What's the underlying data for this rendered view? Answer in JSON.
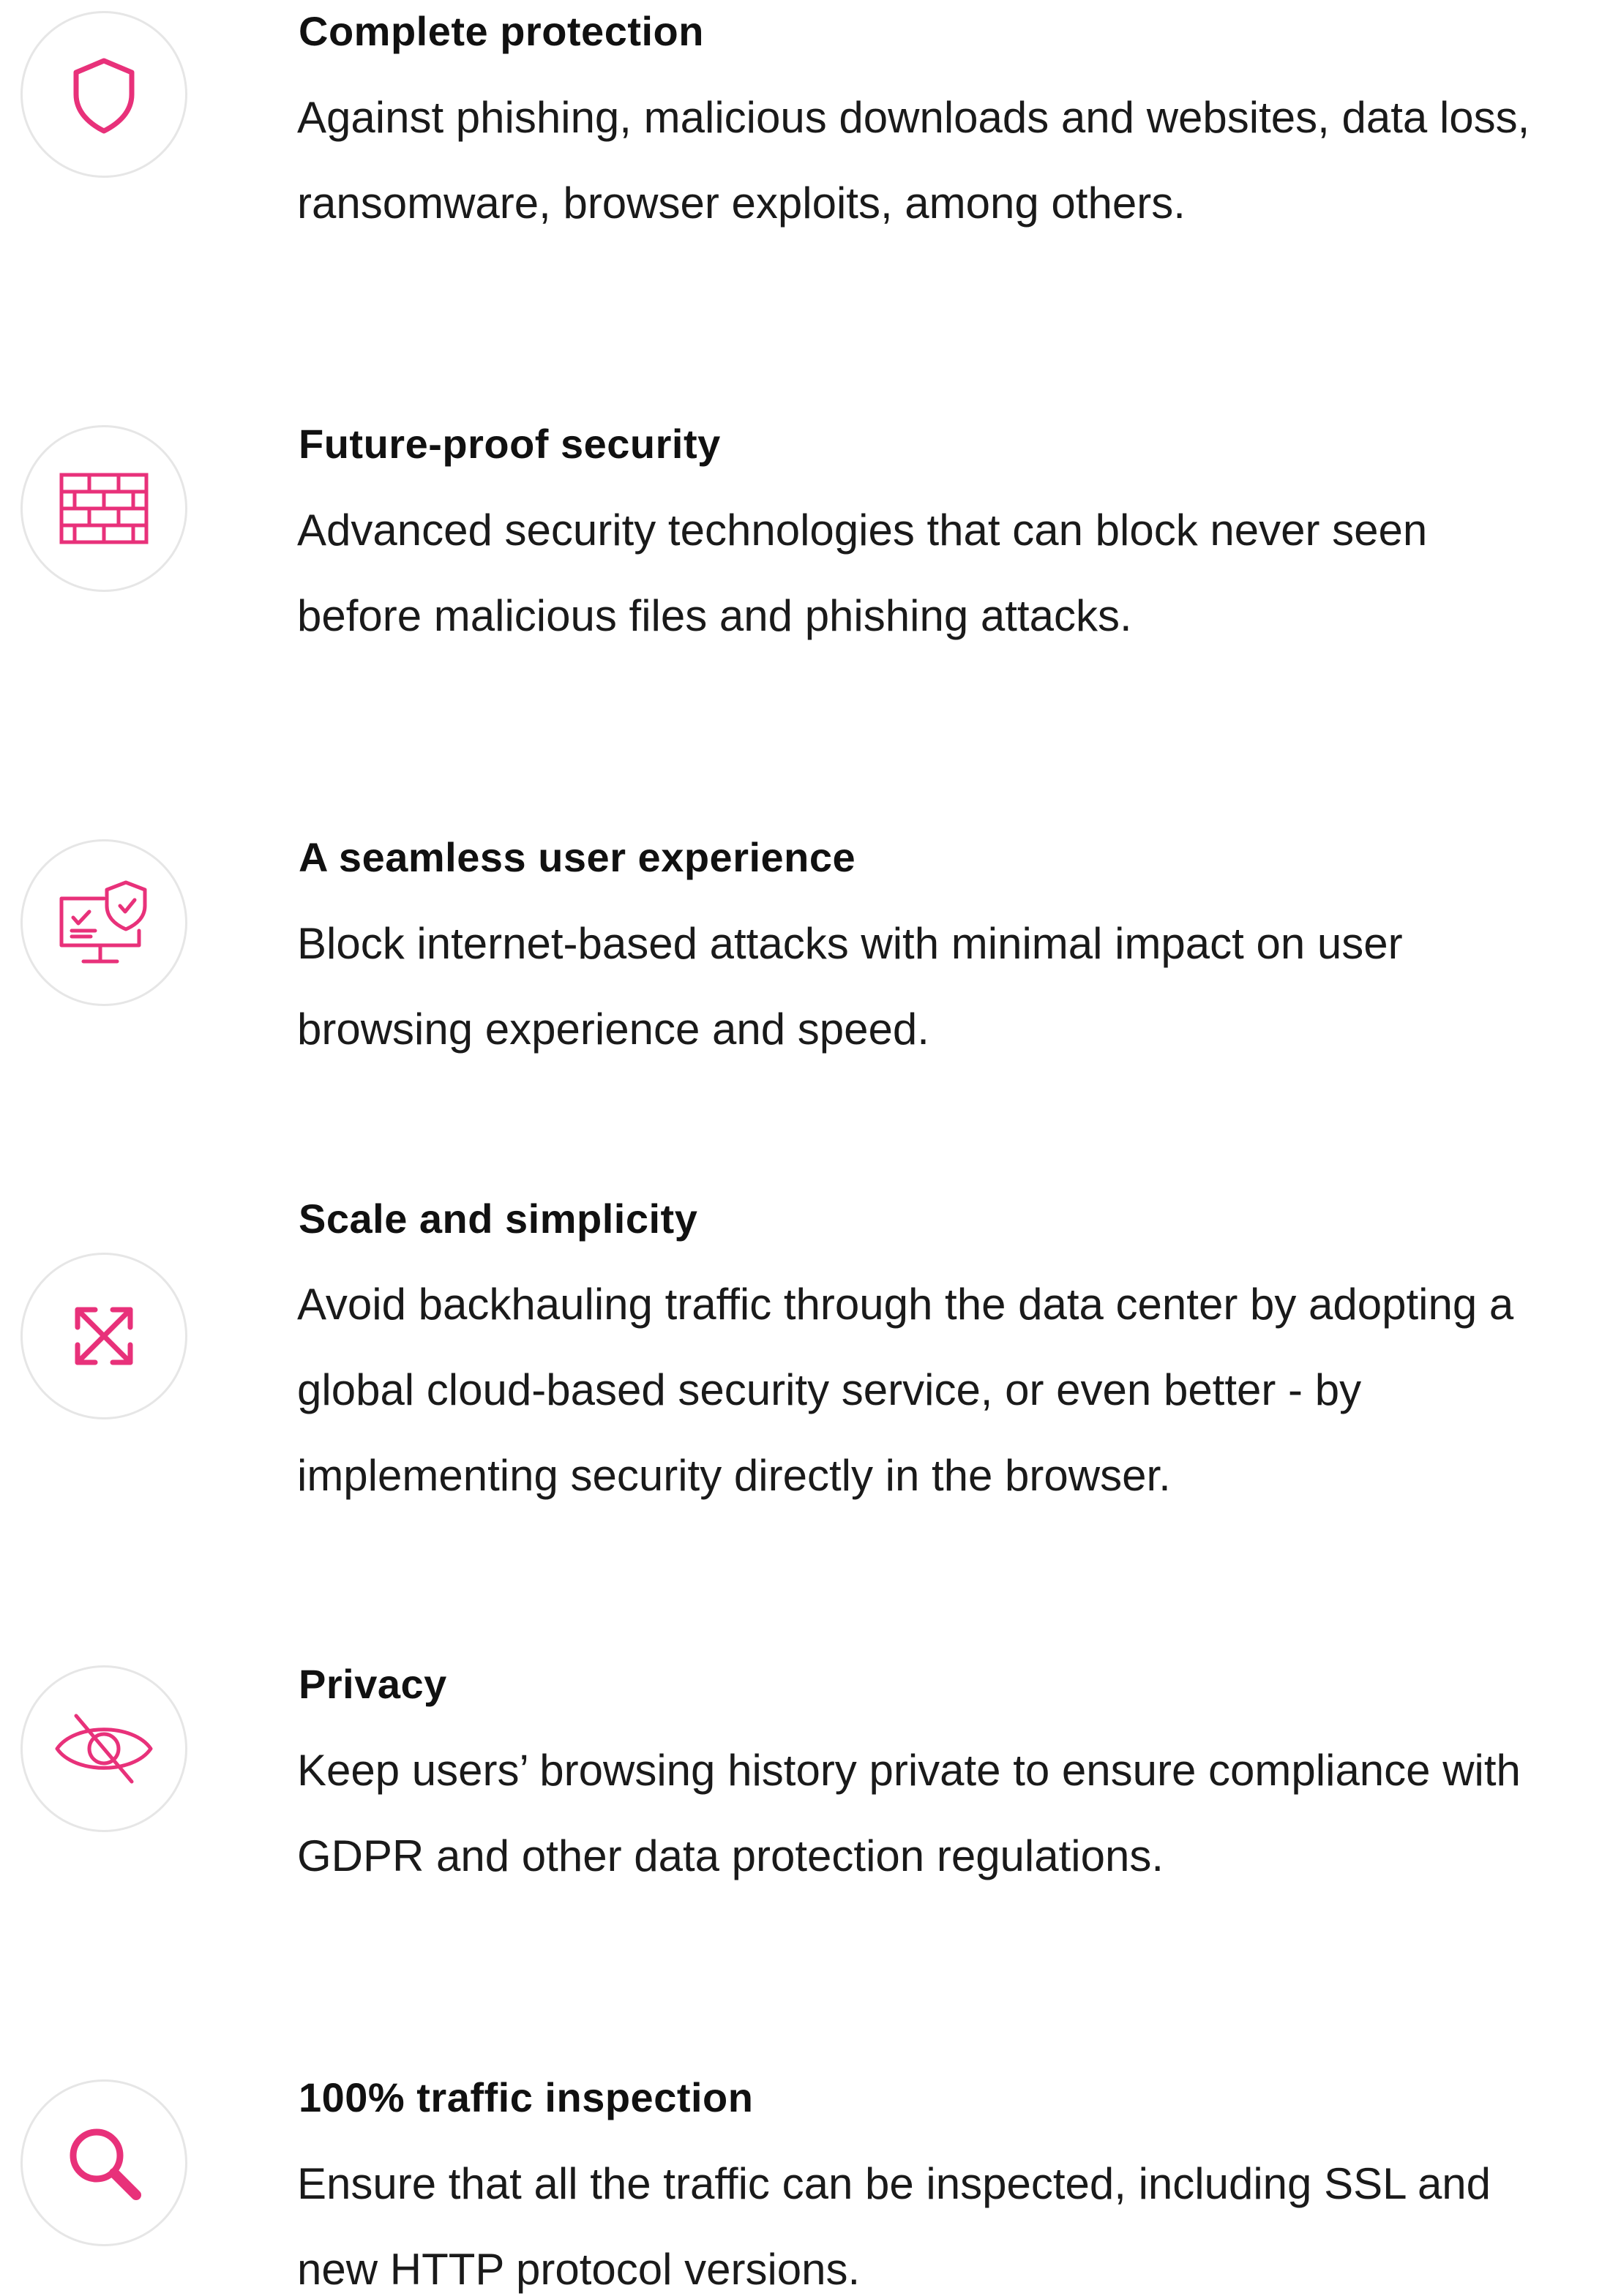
{
  "accent_color": "#e8317a",
  "features": [
    {
      "icon": "shield-icon",
      "title": "Complete protection",
      "lines": [
        "Against phishing, malicious downloads and websites, data loss,",
        "ransomware, browser exploits, among others."
      ]
    },
    {
      "icon": "brick-wall-icon",
      "title": "Future-proof security",
      "lines": [
        "Advanced security technologies that can block never seen",
        "before malicious files and phishing attacks."
      ]
    },
    {
      "icon": "monitor-shield-icon",
      "title": "A seamless user experience",
      "lines": [
        "Block internet-based attacks with minimal impact on user",
        "browsing experience and speed."
      ]
    },
    {
      "icon": "expand-arrows-icon",
      "title": "Scale and simplicity",
      "lines": [
        "Avoid backhauling traffic through the data center by adopting a",
        "global cloud-based security service, or even better - by",
        "implementing security directly in the browser."
      ]
    },
    {
      "icon": "eye-slash-icon",
      "title": "Privacy",
      "lines": [
        "Keep users’ browsing history private to ensure compliance with",
        "GDPR and other data protection regulations."
      ]
    },
    {
      "icon": "magnifier-icon",
      "title": "100% traffic inspection",
      "lines": [
        "Ensure that all the traffic can be inspected, including SSL and",
        "new HTTP protocol versions."
      ]
    }
  ]
}
